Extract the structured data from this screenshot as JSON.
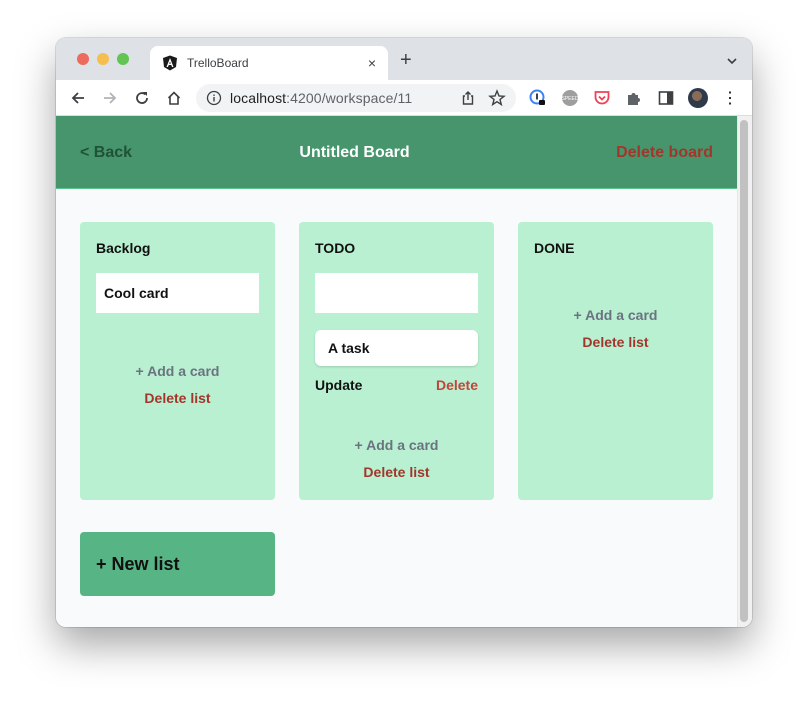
{
  "browser": {
    "tab": {
      "title": "TrelloBoard",
      "favicon": "angular-icon",
      "close_icon": "×"
    },
    "new_tab_icon": "+",
    "address_bar": {
      "host": "localhost",
      "path": ":4200/workspace/11"
    },
    "extensions": [
      "password-manager-icon",
      "yt-speed-icon",
      "pocket-icon",
      "extensions-puzzle-icon",
      "side-panel-icon"
    ],
    "menu_icon": "⋮"
  },
  "header": {
    "back_label": "< Back",
    "title": "Untitled Board",
    "delete_board_label": "Delete board"
  },
  "lists": [
    {
      "title": "Backlog",
      "input_value": "Cool card",
      "input_placeholder": "",
      "cards": [],
      "add_card_label": "+ Add a card",
      "delete_list_label": "Delete list"
    },
    {
      "title": "TODO",
      "input_value": "",
      "input_placeholder": "",
      "cards": [
        {
          "text": "A task",
          "update_label": "Update",
          "delete_label": "Delete"
        }
      ],
      "add_card_label": "+ Add a card",
      "delete_list_label": "Delete list"
    },
    {
      "title": "DONE",
      "cards": [],
      "add_card_label": "+ Add a card",
      "delete_list_label": "Delete list"
    }
  ],
  "new_list_label": "+ New list",
  "colors": {
    "header_bg": "#46956c",
    "list_bg": "#b8f0d1",
    "new_list_bg": "#57b485",
    "danger": "#a3362b",
    "muted": "#6b7280"
  }
}
